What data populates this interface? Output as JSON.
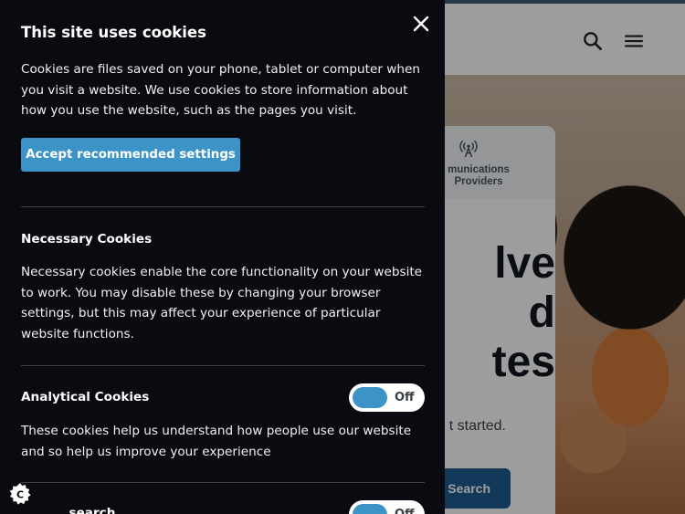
{
  "site": {
    "card_tab_label": "munications\nProviders",
    "hero_title": "lve\nd\ntes",
    "hero_subtitle": "t started.",
    "search_button": "Search"
  },
  "cookie_panel": {
    "title": "This site uses cookies",
    "intro": "Cookies are files saved on your phone, tablet or computer when you visit a website. We use cookies to store information about how you use the website, such as the pages you visit.",
    "accept_button": "Accept recommended settings",
    "sections": [
      {
        "heading": "Necessary Cookies",
        "body": "Necessary cookies enable the core functionality on your website to work. You may disable these by changing your browser settings, but this may affect your experience of particular website functions."
      },
      {
        "heading": "Analytical Cookies",
        "toggle_label": "Off",
        "body": "These cookies help us understand how people use our website and so help us improve your experience"
      },
      {
        "heading": "...search",
        "toggle_label": "Off"
      }
    ]
  },
  "colors": {
    "panel_bg": "#090b10",
    "accent": "#3c93c7",
    "site_button": "#1d5d92"
  },
  "icons": {
    "close": "close-icon",
    "search": "search-icon",
    "menu": "hamburger-menu-icon",
    "tower": "broadcast-tower-icon",
    "cookie": "cookie-settings-icon"
  }
}
